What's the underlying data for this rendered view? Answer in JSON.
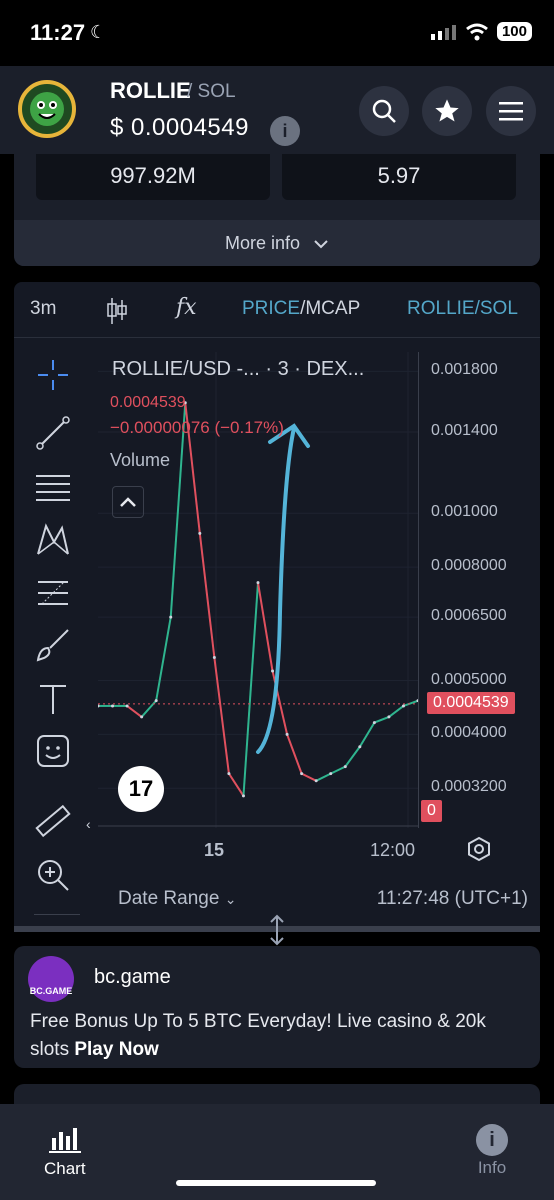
{
  "status": {
    "time": "11:27",
    "battery": "100"
  },
  "header": {
    "token": "ROLLIE",
    "pair_suffix": "/ SOL",
    "price": "$ 0.0004549",
    "info_glyph": "i",
    "actions": [
      "search-icon",
      "star-icon",
      "menu-icon"
    ]
  },
  "stats": {
    "left_value": "997.92M",
    "right_value": "5.97",
    "more_info": "More info"
  },
  "chart": {
    "toolbar": {
      "interval": "3m",
      "fx": "fx",
      "price": "PRICE",
      "slash": "/",
      "mcap": "MCAP",
      "pair": "ROLLIE/SOL"
    },
    "legend": {
      "title": "ROLLIE/USD -...  · 3 · DEX...",
      "price": "0.0004539",
      "change": "−0.00000076 (−0.17%)",
      "volume": "Volume"
    },
    "tv_logo": "17",
    "volume_zero": "0",
    "current_price_badge": "0.0004539",
    "date_range": "Date Range",
    "clock": "11:27:48 (UTC+1)",
    "collapse_glyph": "‹"
  },
  "chart_data": {
    "type": "line",
    "title": "ROLLIE/USD",
    "scale": "log",
    "y_ticks": [
      "0.001800",
      "0.001400",
      "0.001000",
      "0.0008000",
      "0.0006500",
      "0.0005000",
      "0.0004000",
      "0.0003200"
    ],
    "x_ticks": [
      "15",
      "12:00"
    ],
    "series": [
      {
        "name": "ROLLIE/USD",
        "values": [
          0.00045,
          0.00045,
          0.00045,
          0.00043,
          0.00046,
          0.00065,
          0.00158,
          0.00092,
          0.00055,
          0.00034,
          0.00031,
          0.00075,
          0.00052,
          0.0004,
          0.00034,
          0.00033,
          0.00034,
          0.00035,
          0.00038,
          0.00042,
          0.00043,
          0.00045,
          0.00046
        ]
      }
    ],
    "current_price": 0.0004539
  },
  "ad": {
    "logo_text": "BC.GAME",
    "name": "bc.game",
    "text": "Free Bonus Up To 5 BTC Everyday! Live casino & 20k slots",
    "cta": "Play Now"
  },
  "nav": {
    "chart": "Chart",
    "info": "Info"
  }
}
